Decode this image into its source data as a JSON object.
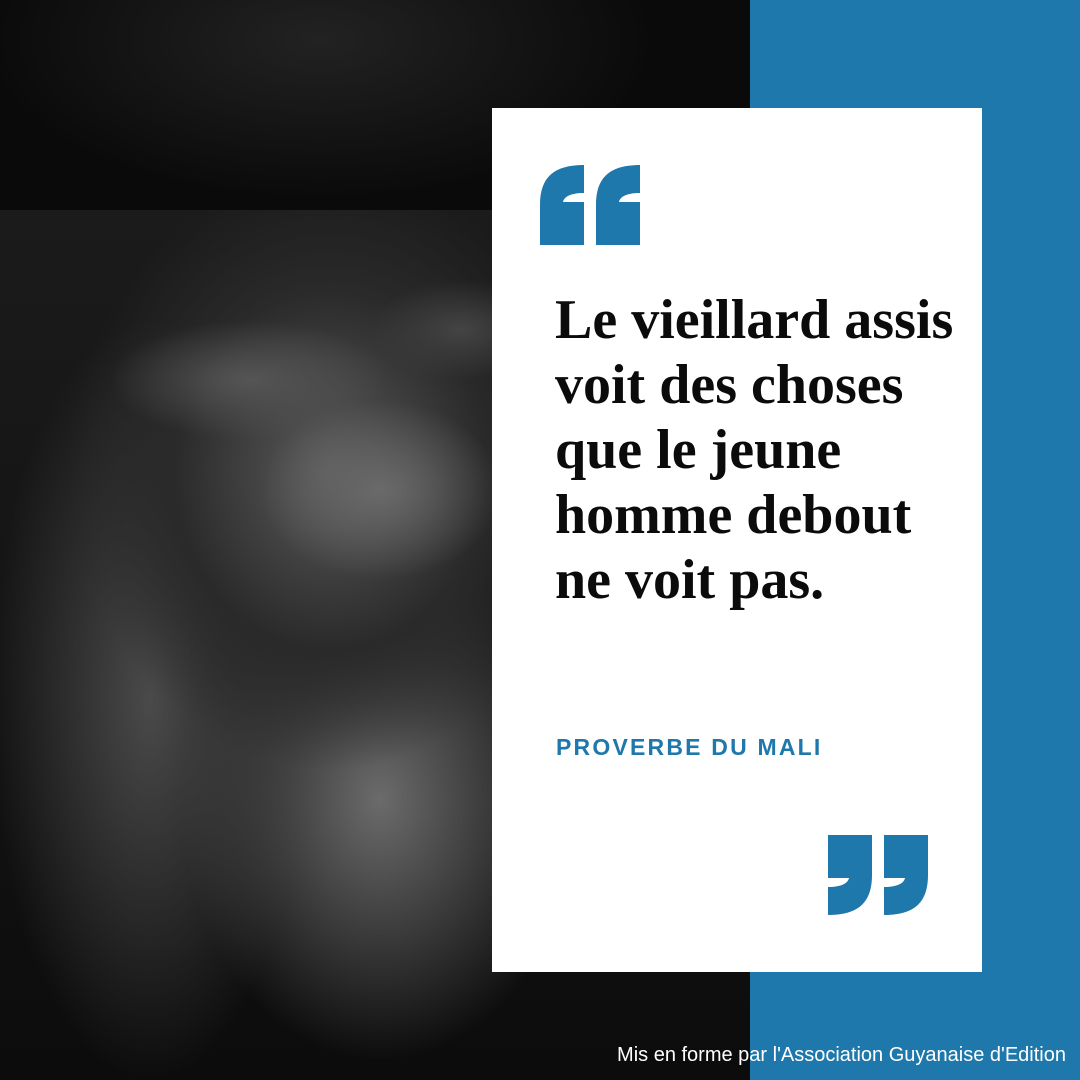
{
  "quote": {
    "text": "Le vieillard assis voit des choses que le jeune homme debout ne voit pas.",
    "author": "PROVERBE DU MALI"
  },
  "credit": "Mis en forme par l'Association Guyanaise d'Edition",
  "colors": {
    "accent": "#1f78ab",
    "card": "#ffffff",
    "text": "#0b0b0b"
  },
  "icons": {
    "open": "open-quote-icon",
    "close": "close-quote-icon"
  }
}
